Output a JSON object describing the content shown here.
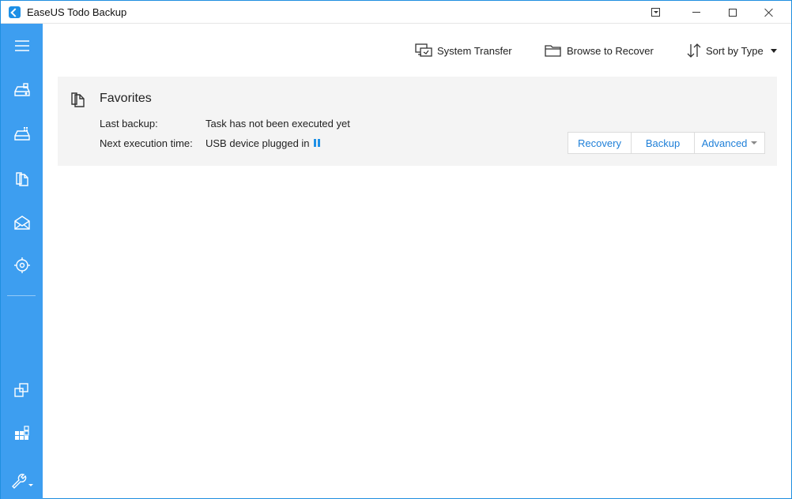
{
  "window": {
    "title": "EaseUS Todo Backup"
  },
  "sidebar": {
    "items": [
      {
        "name": "menu",
        "icon": "hamburger-menu-icon"
      },
      {
        "name": "disk-partition-backup",
        "icon": "disk-backup-icon"
      },
      {
        "name": "system-backup",
        "icon": "system-backup-icon"
      },
      {
        "name": "file-backup",
        "icon": "file-backup-icon"
      },
      {
        "name": "mail-backup",
        "icon": "mail-icon"
      },
      {
        "name": "smart-backup",
        "icon": "target-icon"
      },
      {
        "name": "clone",
        "icon": "clone-icon"
      },
      {
        "name": "system-clone",
        "icon": "windows-grid-icon"
      },
      {
        "name": "tools",
        "icon": "wrench-icon"
      }
    ]
  },
  "toolbar": {
    "system_transfer": "System Transfer",
    "browse_to_recover": "Browse to Recover",
    "sort_by_type": "Sort by Type"
  },
  "task": {
    "title": "Favorites",
    "last_backup_label": "Last backup:",
    "last_backup_value": "Task has not been executed yet",
    "next_execution_label": "Next execution time:",
    "next_execution_value": "USB device plugged in",
    "actions": {
      "recovery": "Recovery",
      "backup": "Backup",
      "advanced": "Advanced"
    }
  },
  "colors": {
    "sidebar": "#3d9ef0",
    "accent": "#1e90e6",
    "card_bg": "#f4f4f4"
  }
}
